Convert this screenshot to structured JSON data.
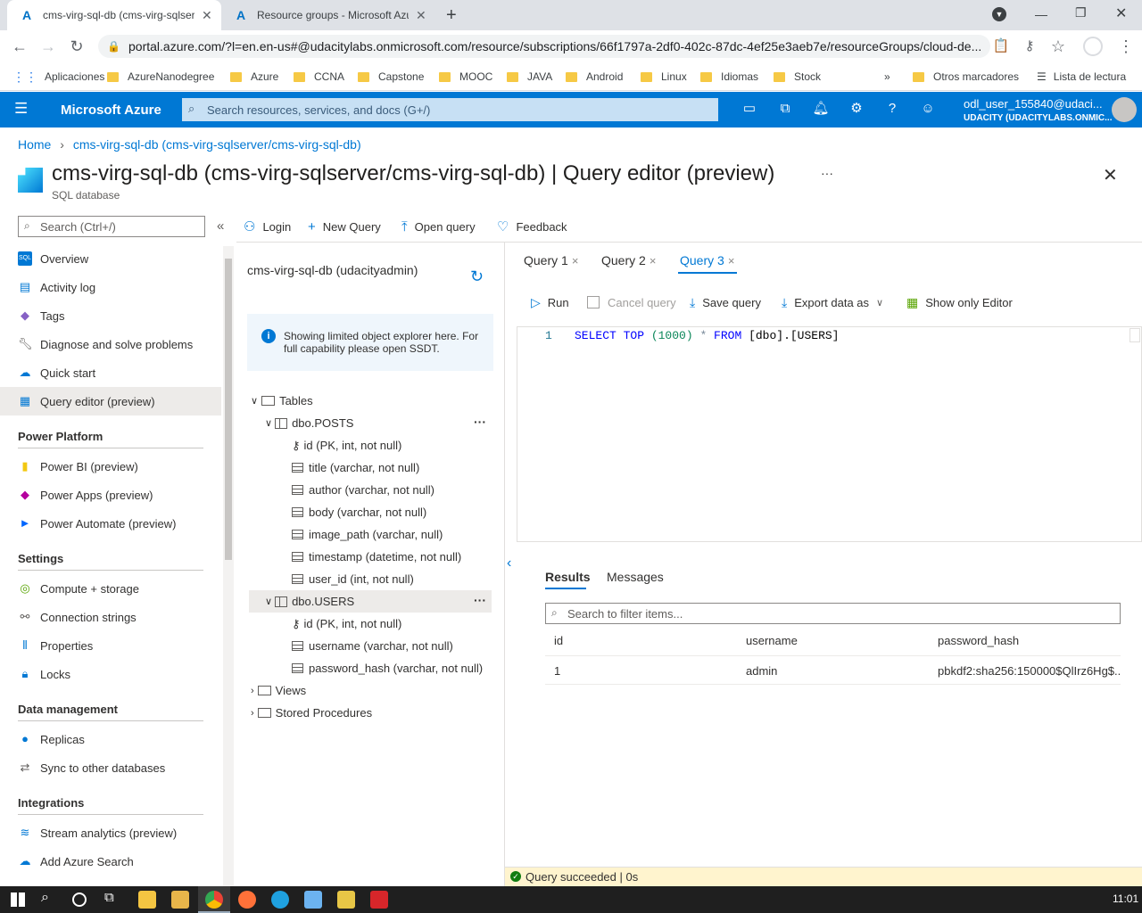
{
  "browser": {
    "tabs": [
      {
        "title": "cms-virg-sql-db (cms-virg-sqlser"
      },
      {
        "title": "Resource groups - Microsoft Azu"
      }
    ],
    "url": "portal.azure.com/?l=en.en-us#@udacitylabs.onmicrosoft.com/resource/subscriptions/66f1797a-2df0-402c-87dc-4ef25e3aeb7e/resourceGroups/cloud-de...",
    "bookmarks": [
      "Aplicaciones",
      "AzureNanodegree",
      "Azure",
      "CCNA",
      "Capstone",
      "MOOC",
      "JAVA",
      "Android",
      "Linux",
      "Idiomas",
      "Stock"
    ],
    "other_bookmarks": "Otros marcadores",
    "reading_list": "Lista de lectura",
    "more": "»"
  },
  "azure": {
    "brand": "Microsoft Azure",
    "search_placeholder": "Search resources, services, and docs (G+/)",
    "user_name": "odl_user_155840@udaci...",
    "user_org": "UDACITY (UDACITYLABS.ONMIC..."
  },
  "page": {
    "breadcrumb_home": "Home",
    "breadcrumb_item": "cms-virg-sql-db (cms-virg-sqlserver/cms-virg-sql-db)",
    "title": "cms-virg-sql-db (cms-virg-sqlserver/cms-virg-sql-db)",
    "title_suffix": " | Query editor (preview)",
    "subtitle": "SQL database",
    "ellipsis": "···"
  },
  "left_menu": {
    "search_placeholder": "Search (Ctrl+/)",
    "collapse": "«",
    "items_top": [
      "Overview",
      "Activity log",
      "Tags",
      "Diagnose and solve problems",
      "Quick start",
      "Query editor (preview)"
    ],
    "section_power": "Power Platform",
    "items_power": [
      "Power BI (preview)",
      "Power Apps (preview)",
      "Power Automate (preview)"
    ],
    "section_settings": "Settings",
    "items_settings": [
      "Compute + storage",
      "Connection strings",
      "Properties",
      "Locks"
    ],
    "section_data": "Data management",
    "items_data": [
      "Replicas",
      "Sync to other databases"
    ],
    "section_integrations": "Integrations",
    "items_integrations": [
      "Stream analytics (preview)",
      "Add Azure Search"
    ]
  },
  "toolbar": {
    "login": "Login",
    "new_query": "New Query",
    "open_query": "Open query",
    "feedback": "Feedback"
  },
  "explorer": {
    "db_title": "cms-virg-sql-db (udacityadmin)",
    "info": "Showing limited object explorer here. For full capability please open SSDT.",
    "tables": "Tables",
    "posts": "dbo.POSTS",
    "posts_cols": [
      "id (PK, int, not null)",
      "title (varchar, not null)",
      "author (varchar, not null)",
      "body (varchar, not null)",
      "image_path (varchar, null)",
      "timestamp (datetime, not null)",
      "user_id (int, not null)"
    ],
    "users": "dbo.USERS",
    "users_cols": [
      "id (PK, int, not null)",
      "username (varchar, not null)",
      "password_hash (varchar, not null)"
    ],
    "views": "Views",
    "procs": "Stored Procedures",
    "more": "···"
  },
  "query": {
    "tabs": [
      "Query 1",
      "Query 2",
      "Query 3"
    ],
    "close": "×",
    "run": "Run",
    "cancel": "Cancel query",
    "save": "Save query",
    "export": "Export data as",
    "show_editor": "Show only Editor",
    "line_no": "1",
    "sql_kw1": "SELECT TOP",
    "sql_num": " (1000) ",
    "sql_star": "*",
    "sql_from": " FROM ",
    "sql_obj": "[dbo].[USERS]",
    "results_tab": "Results",
    "messages_tab": "Messages",
    "filter_placeholder": "Search to filter items...",
    "columns": [
      "id",
      "username",
      "password_hash"
    ],
    "row": [
      "1",
      "admin",
      "pbkdf2:sha256:150000$QlIrz6Hg$..."
    ],
    "status": "Query succeeded | 0s"
  },
  "taskbar": {
    "time": "11:01"
  }
}
